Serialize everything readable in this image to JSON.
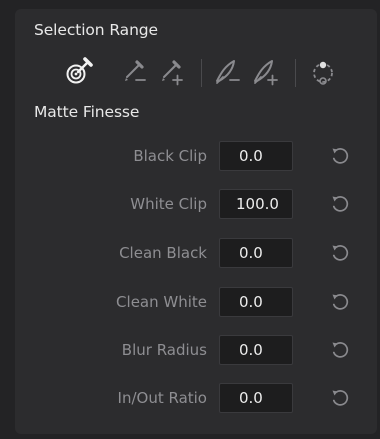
{
  "selection_range": {
    "title": "Selection Range",
    "tools": [
      {
        "icon": "picker-icon",
        "active": true
      },
      {
        "icon": "picker-minus-icon",
        "active": false
      },
      {
        "icon": "picker-plus-icon",
        "active": false
      },
      {
        "icon": "softness-minus-icon",
        "active": false
      },
      {
        "icon": "softness-plus-icon",
        "active": false
      },
      {
        "icon": "invert-icon",
        "active": false
      }
    ]
  },
  "matte_finesse": {
    "title": "Matte Finesse",
    "rows": [
      {
        "label": "Black Clip",
        "value": "0.0"
      },
      {
        "label": "White Clip",
        "value": "100.0"
      },
      {
        "label": "Clean Black",
        "value": "0.0"
      },
      {
        "label": "Clean White",
        "value": "0.0"
      },
      {
        "label": "Blur Radius",
        "value": "0.0"
      },
      {
        "label": "In/Out Ratio",
        "value": "0.0"
      }
    ],
    "reset_icon": "reset-icon"
  },
  "colors": {
    "background": "#232325",
    "panel": "#2c2c2e",
    "title_text": "#e8e8e8",
    "label_text": "#8e8e92",
    "field_bg": "#1d1d1e",
    "active_icon": "#f2f2f2",
    "inactive_icon": "#8a8a8e"
  }
}
